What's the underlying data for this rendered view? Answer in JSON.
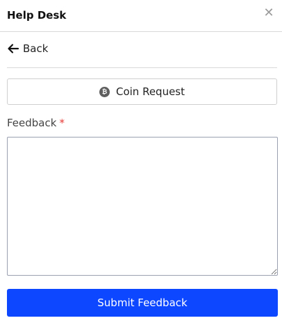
{
  "header": {
    "title": "Help Desk",
    "close_icon": "close-icon"
  },
  "back": {
    "label": "Back",
    "icon": "arrow-left-icon"
  },
  "coin_request": {
    "label": "Coin Request",
    "icon": "bitcoin-icon",
    "icon_glyph": "₿"
  },
  "feedback": {
    "label": "Feedback",
    "required_mark": "*",
    "value": "",
    "placeholder": ""
  },
  "submit": {
    "label": "Submit Feedback"
  },
  "colors": {
    "primary": "#0d47ff",
    "required": "#e53935"
  }
}
